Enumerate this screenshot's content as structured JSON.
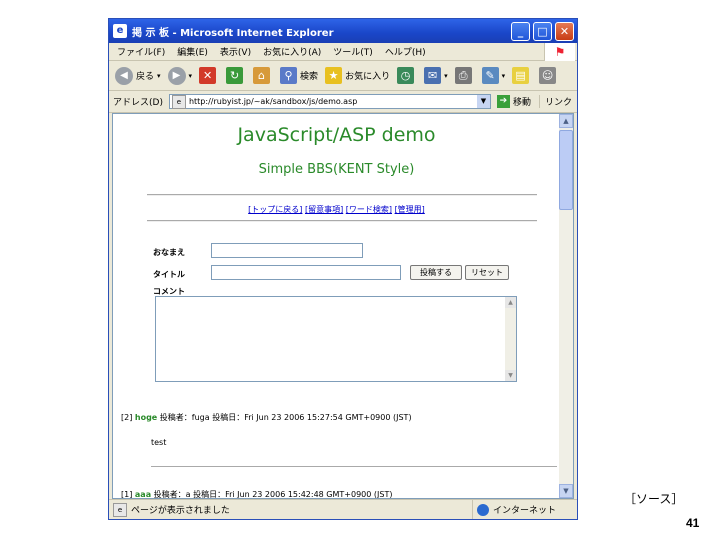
{
  "window": {
    "title": "掲 示 板 - Microsoft Internet Explorer",
    "buttons": {
      "minimize": "_",
      "maximize": "□",
      "close": "✕"
    }
  },
  "menubar": {
    "items": [
      "ファイル(F)",
      "編集(E)",
      "表示(V)",
      "お気に入り(A)",
      "ツール(T)",
      "ヘルプ(H)"
    ]
  },
  "toolbar": {
    "back_label": "戻る",
    "search_label": "検索",
    "favorites_label": "お気に入り"
  },
  "addressbar": {
    "label": "アドレス(D)",
    "url": "http://rubyist.jp/~ak/sandbox/js/demo.asp",
    "go_label": "移動",
    "links_label": "リンク"
  },
  "page": {
    "title": "JavaScript/ASP demo",
    "subtitle": "Simple BBS(KENT Style)",
    "nav": [
      "[トップに戻る]",
      "[留意事項]",
      "[ワード検索]",
      "[管理用]"
    ],
    "form": {
      "name_label": "おなまえ",
      "title_label": "タイトル",
      "comment_label": "コメント",
      "submit_label": "投稿する",
      "reset_label": "リセット"
    },
    "posts": [
      {
        "num": "[2]",
        "name": "hoge",
        "meta": " 投稿者：fuga 投稿日：Fri Jun 23 2006 15:27:54 GMT+0900 (JST)",
        "body": "test"
      },
      {
        "num": "[1]",
        "name": "aaa",
        "meta": " 投稿者：a 投稿日：Fri Jun 23 2006 15:42:48 GMT+0900 (JST)",
        "body": ""
      }
    ]
  },
  "statusbar": {
    "text": "ページが表示されました",
    "zone": "インターネット"
  },
  "slide": {
    "caption": "［ソース］",
    "page_number": "41"
  }
}
